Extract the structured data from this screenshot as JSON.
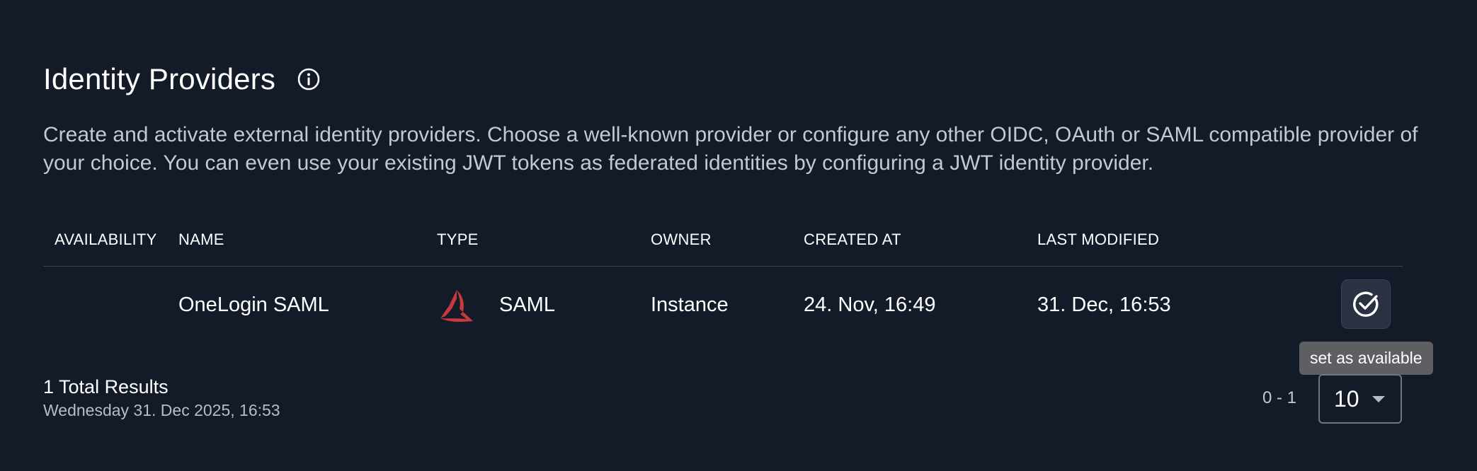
{
  "header": {
    "title": "Identity Providers",
    "info_icon": "info-circle-icon",
    "description": "Create and activate external identity providers. Choose a well-known provider or configure any other OIDC, OAuth or SAML compatible provider of your choice. You can even use your existing JWT tokens as federated identities by configuring a JWT identity provider."
  },
  "table": {
    "columns": [
      "AVAILABILITY",
      "NAME",
      "TYPE",
      "OWNER",
      "CREATED AT",
      "LAST MODIFIED"
    ],
    "rows": [
      {
        "availability": "",
        "name": "OneLogin SAML",
        "type_icon": "saml-logo-icon",
        "type": "SAML",
        "owner": "Instance",
        "created_at": "24. Nov, 16:49",
        "last_modified": "31. Dec, 16:53",
        "action_icon": "check-circle-icon"
      }
    ]
  },
  "tooltip": {
    "text": "set as available"
  },
  "footer": {
    "total": "1 Total Results",
    "timestamp": "Wednesday 31. Dec 2025, 16:53",
    "range": "0 - 1",
    "page_size": "10"
  },
  "colors": {
    "background": "#131a28",
    "saml_logo": "#c8393c",
    "tooltip_bg": "#5e5f63"
  }
}
